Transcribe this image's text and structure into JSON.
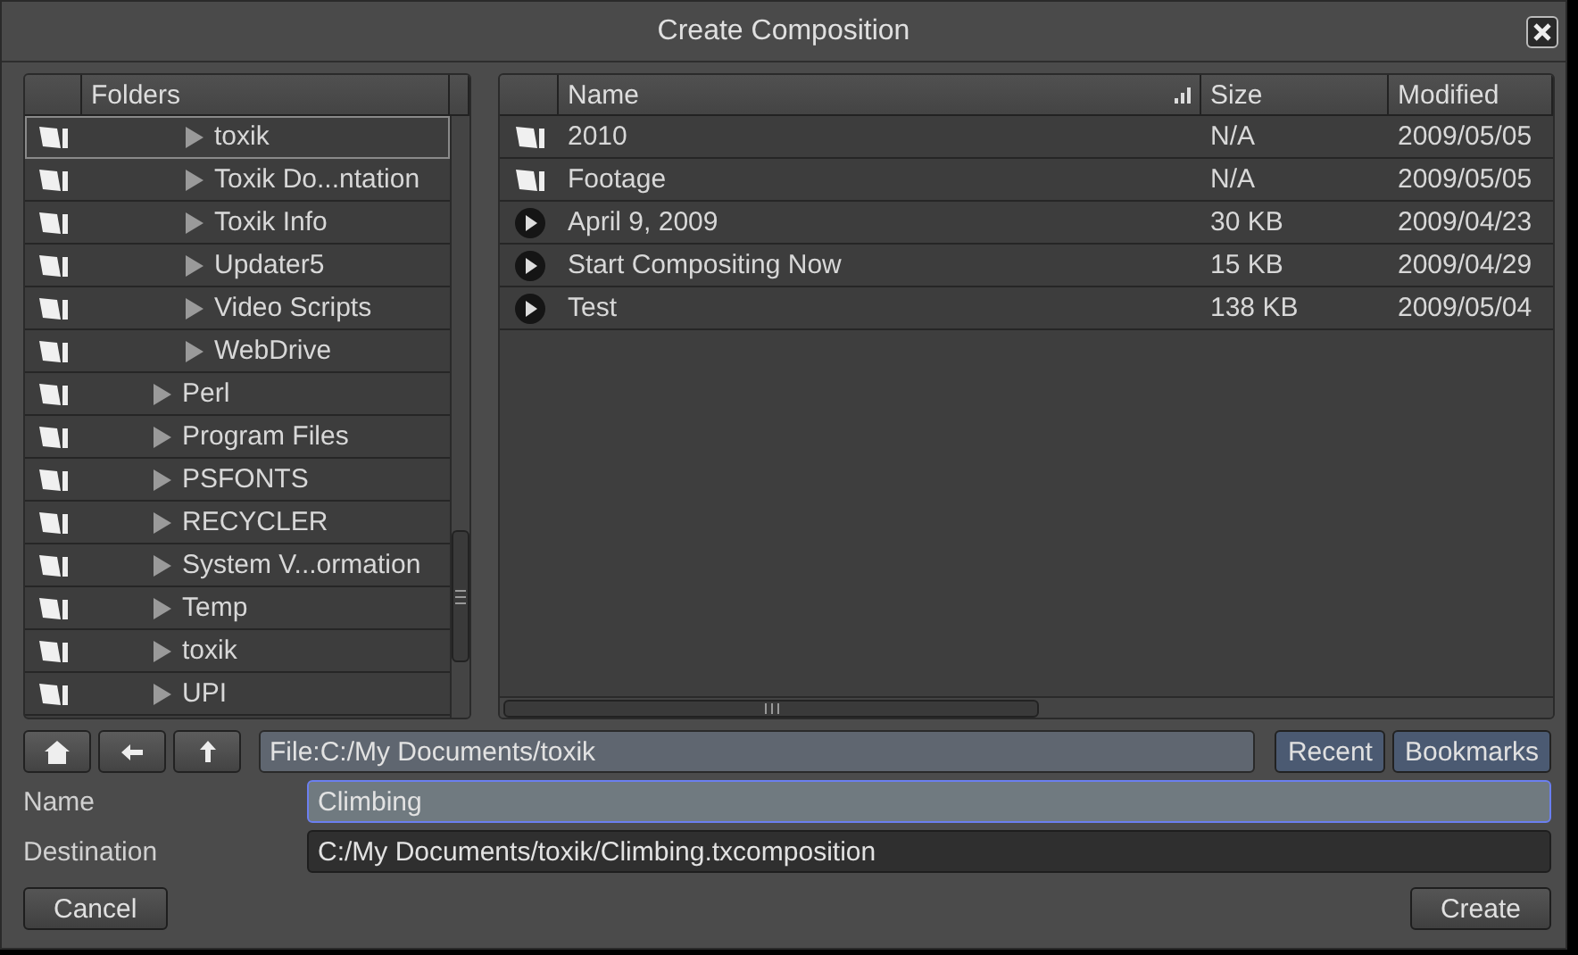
{
  "window": {
    "title": "Create Composition"
  },
  "folders": {
    "heading": "Folders",
    "items": [
      {
        "children": [
          {
            "label": "toxik",
            "selected": true
          },
          {
            "label": "Toxik Do...ntation",
            "selected": false
          },
          {
            "label": "Toxik Info",
            "selected": false
          },
          {
            "label": "Updater5",
            "selected": false
          },
          {
            "label": "Video Scripts",
            "selected": false
          },
          {
            "label": "WebDrive",
            "selected": false
          }
        ]
      },
      {
        "label": "Perl",
        "selected": false
      },
      {
        "label": "Program Files",
        "selected": false
      },
      {
        "label": "PSFONTS",
        "selected": false
      },
      {
        "label": "RECYCLER",
        "selected": false
      },
      {
        "label": "System V...ormation",
        "selected": false
      },
      {
        "label": "Temp",
        "selected": false
      },
      {
        "label": "toxik",
        "selected": false
      },
      {
        "label": "UPI",
        "selected": false
      }
    ]
  },
  "files": {
    "columns": [
      "Name",
      "Size",
      "Modified"
    ],
    "rows": [
      {
        "kind": "folder",
        "name": "2010",
        "size": "N/A",
        "modified": "2009/05/05"
      },
      {
        "kind": "folder",
        "name": "Footage",
        "size": "N/A",
        "modified": "2009/05/05"
      },
      {
        "kind": "composition",
        "name": "April 9, 2009",
        "size": "30 KB",
        "modified": "2009/04/23"
      },
      {
        "kind": "composition",
        "name": "Start Compositing Now",
        "size": "15 KB",
        "modified": "2009/04/29"
      },
      {
        "kind": "composition",
        "name": "Test",
        "size": "138 KB",
        "modified": "2009/05/04"
      }
    ]
  },
  "path": {
    "value": "File:C:/My Documents/toxik"
  },
  "path_buttons": [
    "Recent",
    "Bookmarks"
  ],
  "name_field": {
    "label": "Name",
    "value": "Climbing"
  },
  "destination_field": {
    "label": "Destination",
    "value": "C:/My Documents/toxik/Climbing.txcomposition"
  },
  "buttons": {
    "cancel": "Cancel",
    "create": "Create"
  }
}
